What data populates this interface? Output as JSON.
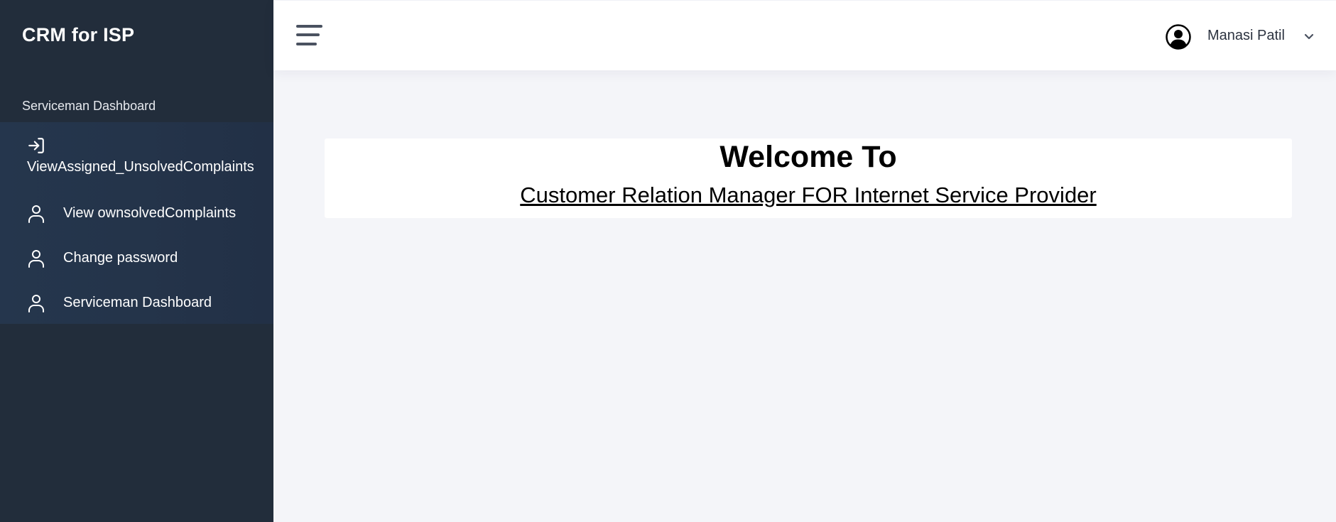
{
  "app": {
    "brand": "CRM for ISP"
  },
  "sidebar": {
    "section_title": "Serviceman Dashboard",
    "items": [
      {
        "label": "ViewAssigned_UnsolvedComplaints",
        "icon": "login-arrow-icon"
      },
      {
        "label": "View ownsolvedComplaints",
        "icon": "user-icon"
      },
      {
        "label": "Change password",
        "icon": "user-icon"
      },
      {
        "label": "Serviceman Dashboard",
        "icon": "user-icon"
      }
    ]
  },
  "header": {
    "menu_icon": "hamburger-menu-icon",
    "user": {
      "name": "Manasi Patil",
      "avatar_icon": "user-avatar-icon",
      "dropdown_icon": "chevron-down-icon"
    }
  },
  "main": {
    "welcome_title": "Welcome To",
    "welcome_subtitle": "Customer Relation Manager FOR Internet Service Provider"
  },
  "colors": {
    "sidebar_bg": "#222d3b",
    "menu_bg": "#25364d",
    "page_bg": "#f4f5f9",
    "header_bg": "#ffffff"
  }
}
